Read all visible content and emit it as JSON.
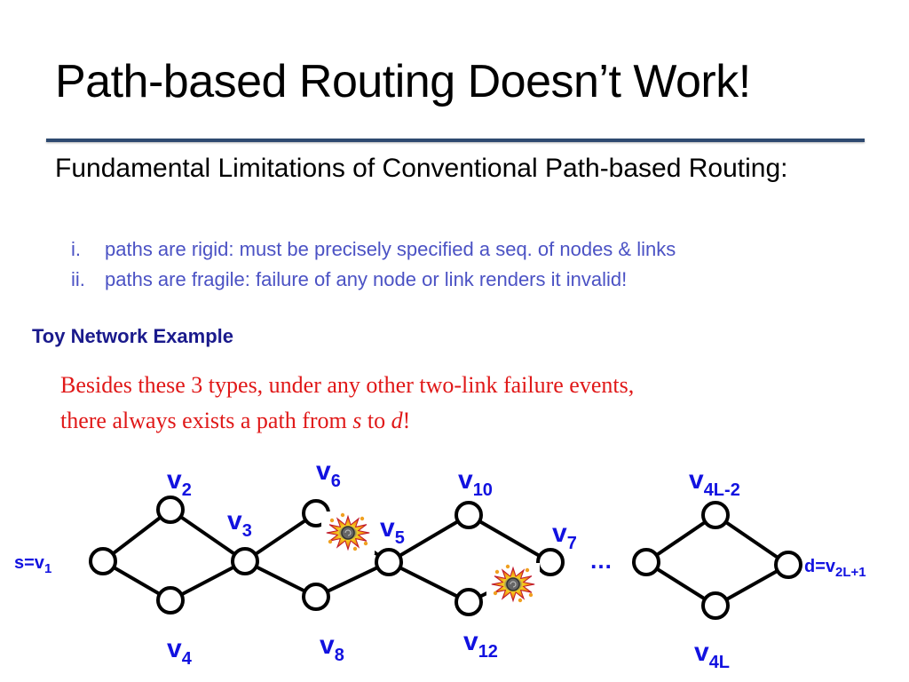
{
  "slide": {
    "title": "Path-based Routing Doesn’t Work!",
    "heading": "Fundamental Limitations of Conventional Path-based Routing:",
    "limitations": [
      {
        "num": "i.",
        "text": "paths are rigid: must be precisely specified a seq. of nodes & links"
      },
      {
        "num": "ii.",
        "text": "paths are fragile: failure of any node or link renders it invalid!"
      }
    ],
    "example_title": "Toy Network Example",
    "claim": {
      "line1": "Besides these 3 types, under any other two-link failure events,",
      "line2_pre": "there always exists a path from ",
      "s": "s",
      "mid": " to ",
      "d": "d",
      "end": "!"
    }
  },
  "diagram": {
    "nodes": [
      {
        "id": "v1",
        "label": "s=v",
        "sub": "1"
      },
      {
        "id": "v2",
        "label": "v",
        "sub": "2"
      },
      {
        "id": "v3",
        "label": "v",
        "sub": "3"
      },
      {
        "id": "v4",
        "label": "v",
        "sub": "4"
      },
      {
        "id": "v5",
        "label": "v",
        "sub": "5"
      },
      {
        "id": "v6",
        "label": "v",
        "sub": "6"
      },
      {
        "id": "v7",
        "label": "v",
        "sub": "7"
      },
      {
        "id": "v8",
        "label": "v",
        "sub": "8"
      },
      {
        "id": "v10",
        "label": "v",
        "sub": "10"
      },
      {
        "id": "v12",
        "label": "v",
        "sub": "12"
      },
      {
        "id": "v4L-2",
        "label": "v",
        "sub": "4L-2"
      },
      {
        "id": "v4L",
        "label": "v",
        "sub": "4L"
      },
      {
        "id": "v2L+1",
        "label": "d=v",
        "sub": "2L+1"
      }
    ],
    "edges": [
      [
        "v1",
        "v2"
      ],
      [
        "v1",
        "v4"
      ],
      [
        "v2",
        "v3"
      ],
      [
        "v4",
        "v3"
      ],
      [
        "v3",
        "v6"
      ],
      [
        "v3",
        "v8"
      ],
      [
        "v6",
        "v5"
      ],
      [
        "v8",
        "v5"
      ],
      [
        "v5",
        "v10"
      ],
      [
        "v5",
        "v12"
      ],
      [
        "v10",
        "v7"
      ],
      [
        "v12",
        "v7"
      ],
      [
        "v2L-1",
        "v4L-2"
      ],
      [
        "v2L-1",
        "v4L"
      ],
      [
        "v4L-2",
        "v2L+1"
      ],
      [
        "v4L",
        "v2L+1"
      ]
    ],
    "failed_links": [
      [
        "v6",
        "v5"
      ],
      [
        "v12",
        "v7"
      ]
    ],
    "ellipsis": "…",
    "node_color": "#ffffff",
    "label_color": "#1212e0",
    "edge_color": "#000000"
  }
}
